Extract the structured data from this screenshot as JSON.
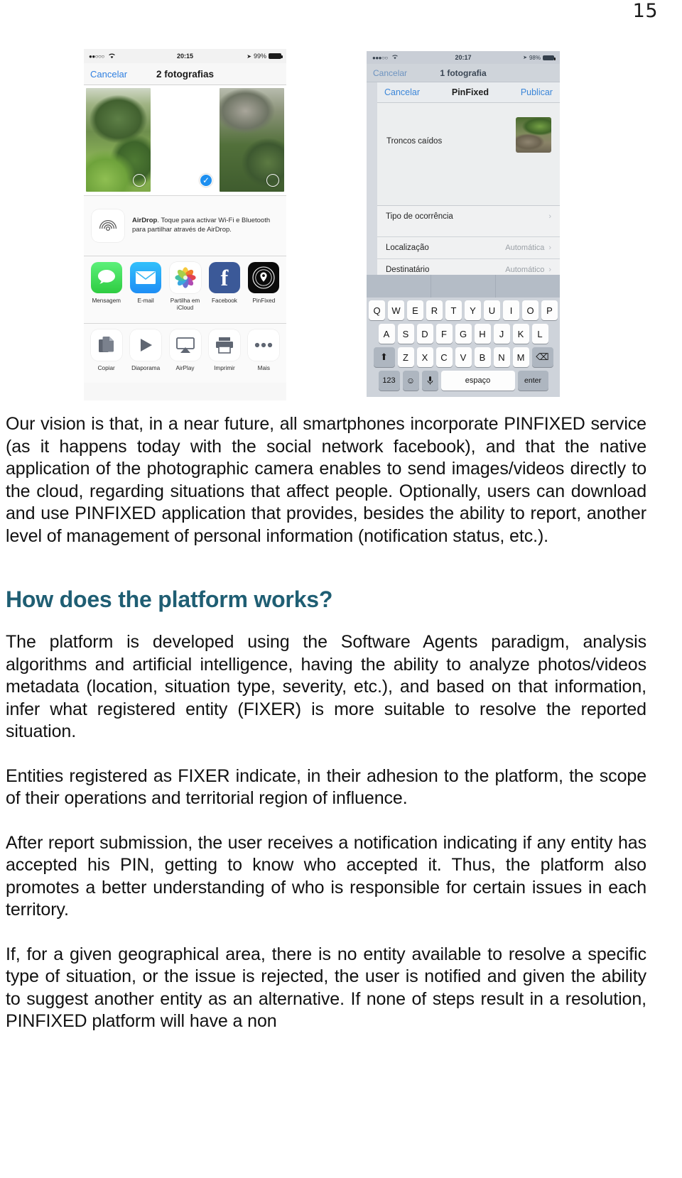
{
  "page": {
    "number": "15"
  },
  "figure": {
    "left_phone": {
      "status": {
        "signal_dots": "●●○○○",
        "wifi": "wifi-icon",
        "time": "20:15",
        "location_arrow": "➤",
        "battery_pct": "99%"
      },
      "navbar": {
        "cancel": "Cancelar",
        "title": "2 fotografias"
      },
      "thumbnails": [
        {
          "name": "garden-photo-1",
          "selected": false
        },
        {
          "name": "garden-photo-2",
          "selected": true
        },
        {
          "name": "garden-photo-3",
          "selected": false
        }
      ],
      "airdrop": {
        "icon": "airdrop-icon",
        "bold": "AirDrop",
        "text": ". Toque para activar Wi-Fi e Bluetooth para partilhar através de AirDrop."
      },
      "share_apps": [
        {
          "label": "Mensagem",
          "icon": "messages-icon"
        },
        {
          "label": "E-mail",
          "icon": "mail-icon"
        },
        {
          "label": "Partilha em iCloud",
          "icon": "photos-icon"
        },
        {
          "label": "Facebook",
          "icon": "facebook-icon"
        },
        {
          "label": "PinFixed",
          "icon": "pinfixed-icon"
        }
      ],
      "actions": [
        {
          "label": "Copiar",
          "icon": "copy-icon"
        },
        {
          "label": "Diaporama",
          "icon": "play-icon"
        },
        {
          "label": "AirPlay",
          "icon": "airplay-icon"
        },
        {
          "label": "Imprimir",
          "icon": "printer-icon"
        },
        {
          "label": "Mais",
          "icon": "ellipsis-icon"
        }
      ]
    },
    "right_phone": {
      "status": {
        "signal_dots": "●●●○○",
        "wifi": "wifi-icon",
        "time": "20:17",
        "location_arrow": "➤",
        "battery_pct": "98%"
      },
      "under_navbar": {
        "cancel": "Cancelar",
        "title": "1 fotografia"
      },
      "compose_nav": {
        "cancel": "Cancelar",
        "title": "PinFixed",
        "publish": "Publicar"
      },
      "compose_text": "Troncos caídos",
      "form_rows": [
        {
          "label": "Tipo de ocorrência",
          "value": ""
        },
        {
          "label": "Localização",
          "value": "Automática"
        },
        {
          "label": "Destinatário",
          "value": "Automático"
        }
      ],
      "keyboard": {
        "row1": [
          "Q",
          "W",
          "E",
          "R",
          "T",
          "Y",
          "U",
          "I",
          "O",
          "P"
        ],
        "row2": [
          "A",
          "S",
          "D",
          "F",
          "G",
          "H",
          "J",
          "K",
          "L"
        ],
        "row3": [
          "Z",
          "X",
          "C",
          "V",
          "B",
          "N",
          "M"
        ],
        "shift": "⬆",
        "backspace": "⌫",
        "numbers": "123",
        "emoji": "☺",
        "mic": "🎤",
        "space": "espaço",
        "enter": "enter"
      }
    }
  },
  "content": {
    "paragraph_1": "Our vision is that, in a near future, all smartphones incorporate PINFIXED service (as it happens today with the social network facebook), and that the native application of the photographic camera enables to send images/videos directly to the cloud, regarding situations that affect people. Optionally, users can download and use PINFIXED application that provides, besides the ability to report, another level of management of personal information (notification status, etc.).",
    "heading_1": "How does the platform works?",
    "paragraph_2": "The platform is developed using the Software Agents paradigm, analysis algorithms and artificial intelligence, having the ability to analyze photos/videos metadata (location, situation type, severity, etc.), and based on that information, infer what registered entity (FIXER) is more suitable to resolve the reported situation.",
    "paragraph_3": "Entities registered as FIXER indicate, in their adhesion to the platform, the scope of their operations and territorial region of influence.",
    "paragraph_4": "After report submission, the user receives a notification indicating if any entity has accepted his PIN, getting to know who accepted it. Thus, the platform also promotes a better understanding of who is responsible for certain issues in each territory.",
    "paragraph_5": "If, for a given geographical area, there is no entity available to resolve a specific type of situation, or the issue is rejected,  the user is notified and given the ability to suggest another entity as an alternative. If none of steps result in a resolution, PINFIXED platform will have a non"
  },
  "colors": {
    "heading": "#1f5e73",
    "ios_blue": "#3b86d8",
    "selection_blue": "#1d8ff0"
  }
}
